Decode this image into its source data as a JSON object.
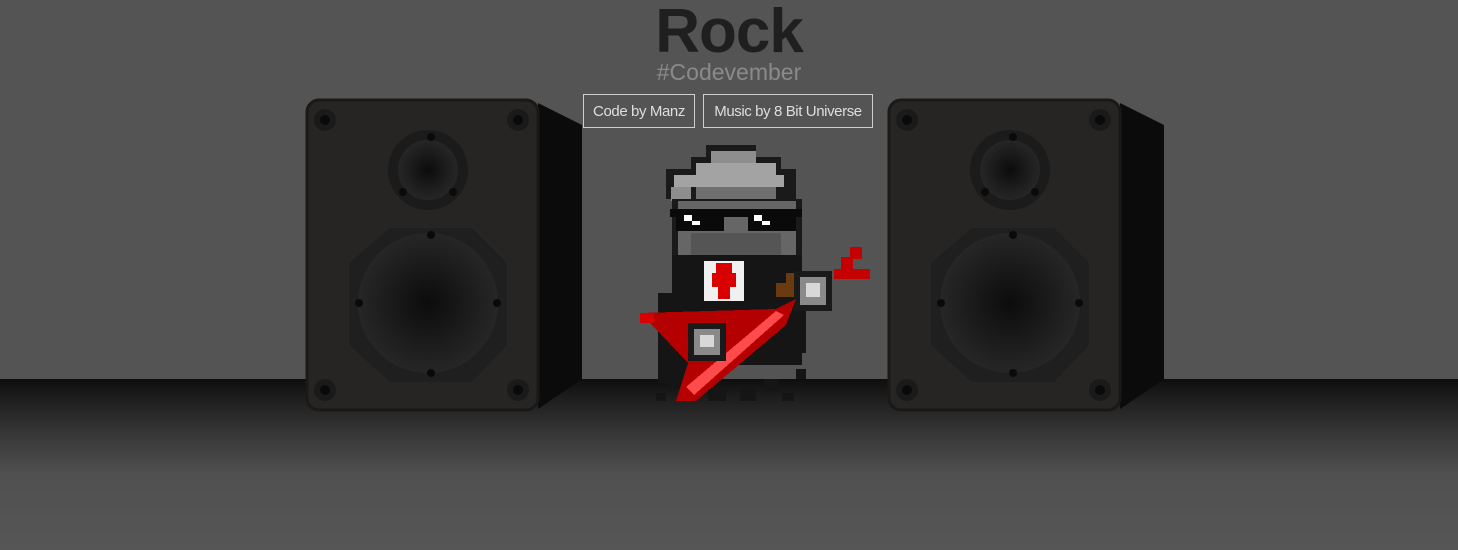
{
  "header": {
    "title": "Rock",
    "subtitle": "#Codevember"
  },
  "credits": {
    "code_label": "Code by Manz",
    "music_label": "Music by 8 Bit Universe"
  },
  "icons": {
    "left_speaker": "speaker-icon",
    "right_speaker": "speaker-icon",
    "character": "pixel-rocker-with-guitar"
  },
  "colors": {
    "background": "#545454",
    "title": "#1f1f1f",
    "subtitle": "#8a8a8a",
    "credit_border": "#cfcfcf",
    "speaker_body": "#262523",
    "guitar": "#b40000"
  }
}
